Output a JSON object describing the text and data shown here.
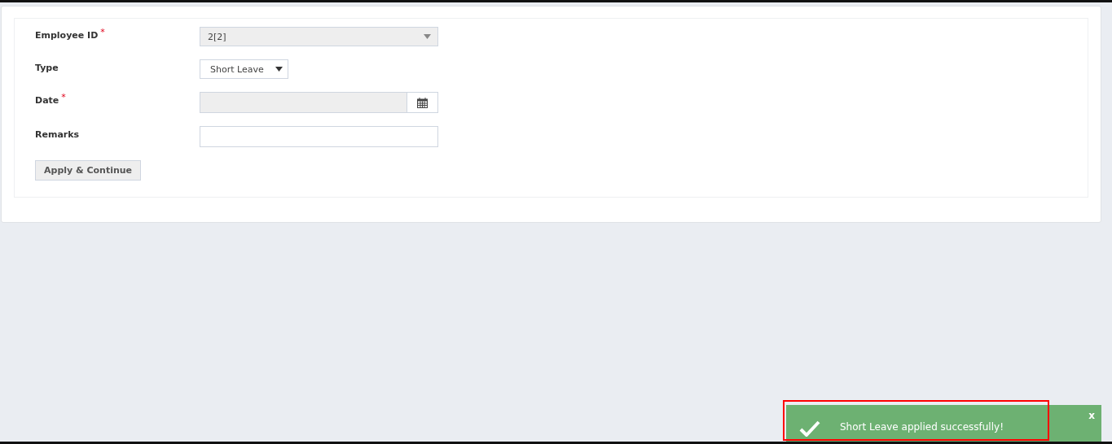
{
  "form": {
    "fields": [
      {
        "label": "Employee ID",
        "marker": "*",
        "kind": "combo",
        "value": "2[2]",
        "disabled": true
      },
      {
        "label": "Type",
        "kind": "select",
        "value": "Short Leave",
        "disabled": false
      },
      {
        "label": "Date",
        "marker": "*",
        "kind": "date",
        "disabled": true
      },
      {
        "label": "Remarks",
        "kind": "text",
        "disabled": false
      }
    ],
    "submit": "Apply & Continue"
  },
  "toast": {
    "message": "Short Leave applied successfully!",
    "close": "x",
    "highlighted": true
  }
}
